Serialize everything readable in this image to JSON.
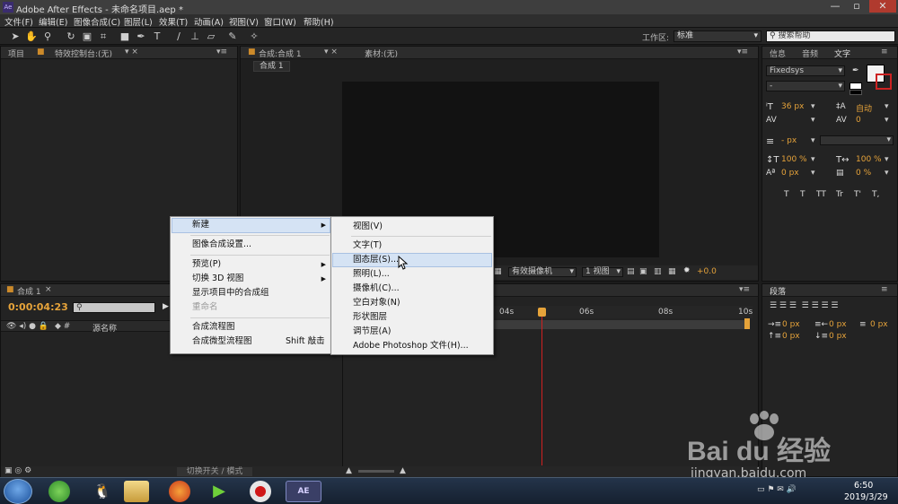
{
  "window": {
    "title": "Adobe After Effects - 未命名项目.aep *",
    "app_icon": "Ae"
  },
  "menu": [
    "文件(F)",
    "编辑(E)",
    "图像合成(C)",
    "图层(L)",
    "效果(T)",
    "动画(A)",
    "视图(V)",
    "窗口(W)",
    "帮助(H)"
  ],
  "toolbar": {
    "workspace_label": "工作区:",
    "workspace_value": "标准",
    "search_placeholder": "搜索帮助"
  },
  "panels": {
    "project_tab": "项目",
    "effects_tab": "特效控制台:(无)",
    "comp_tab": "合成:合成 1",
    "footage_tab": "素材:(无)",
    "comp_subtab": "合成 1",
    "info_tab": "信息",
    "audio_tab": "音频",
    "text_tab": "文字",
    "para_tab": "段落",
    "timeline_tab": "合成 1"
  },
  "char": {
    "font": "Fixedsys",
    "style": "-",
    "size": "36 px",
    "leading": "自动",
    "kerning": "0",
    "stroke": "- px",
    "vscale": "100 %",
    "hscale": "100 %",
    "baseline": "0 px",
    "tsume": "0 %",
    "styles": [
      "T",
      "T",
      "TT",
      "Tr",
      "T'",
      "T,"
    ]
  },
  "para": {
    "indent_l": "0 px",
    "indent_r": "0 px",
    "first": "0 px",
    "space_b": "0 px",
    "space_a": "0 px"
  },
  "viewer_bar": {
    "camera": "有效摄像机",
    "views": "1 视图",
    "exposure": "+0.0"
  },
  "timeline": {
    "timecode": "0:00:04:23",
    "col_source": "源名称",
    "ticks": [
      "04s",
      "06s",
      "08s",
      "10s"
    ],
    "switch_label": "切换开关 / 模式"
  },
  "context_menu": {
    "items": [
      {
        "label": "新建",
        "submenu": true
      },
      {
        "label": "图像合成设置...",
        "submenu": false
      },
      {
        "label": "预览(P)",
        "submenu": true
      },
      {
        "label": "切换 3D 视图",
        "submenu": true
      },
      {
        "label": "显示项目中的合成组",
        "submenu": false
      },
      {
        "label": "重命名",
        "submenu": false,
        "disabled": true
      },
      {
        "label": "合成流程图",
        "submenu": false
      },
      {
        "label": "合成微型流程图",
        "shortcut": "Shift 敲击",
        "submenu": false
      }
    ],
    "submenu_items": [
      "视图(V)",
      "文字(T)",
      "固态层(S)...",
      "照明(L)...",
      "摄像机(C)...",
      "空白对象(N)",
      "形状图层",
      "调节层(A)",
      "Adobe Photoshop 文件(H)..."
    ],
    "highlight_submenu_index": 2
  },
  "taskbar": {
    "time": "6:50",
    "date": "2019/3/29",
    "ae_label": "AE"
  },
  "watermark": {
    "brand": "Bai du 经验",
    "url": "jingyan.baidu.com"
  },
  "colors": {
    "accent_orange": "#e6a33a",
    "ae_purple": "#3a2c6e",
    "highlight": "#d5e3f4",
    "playhead": "#d02020"
  }
}
